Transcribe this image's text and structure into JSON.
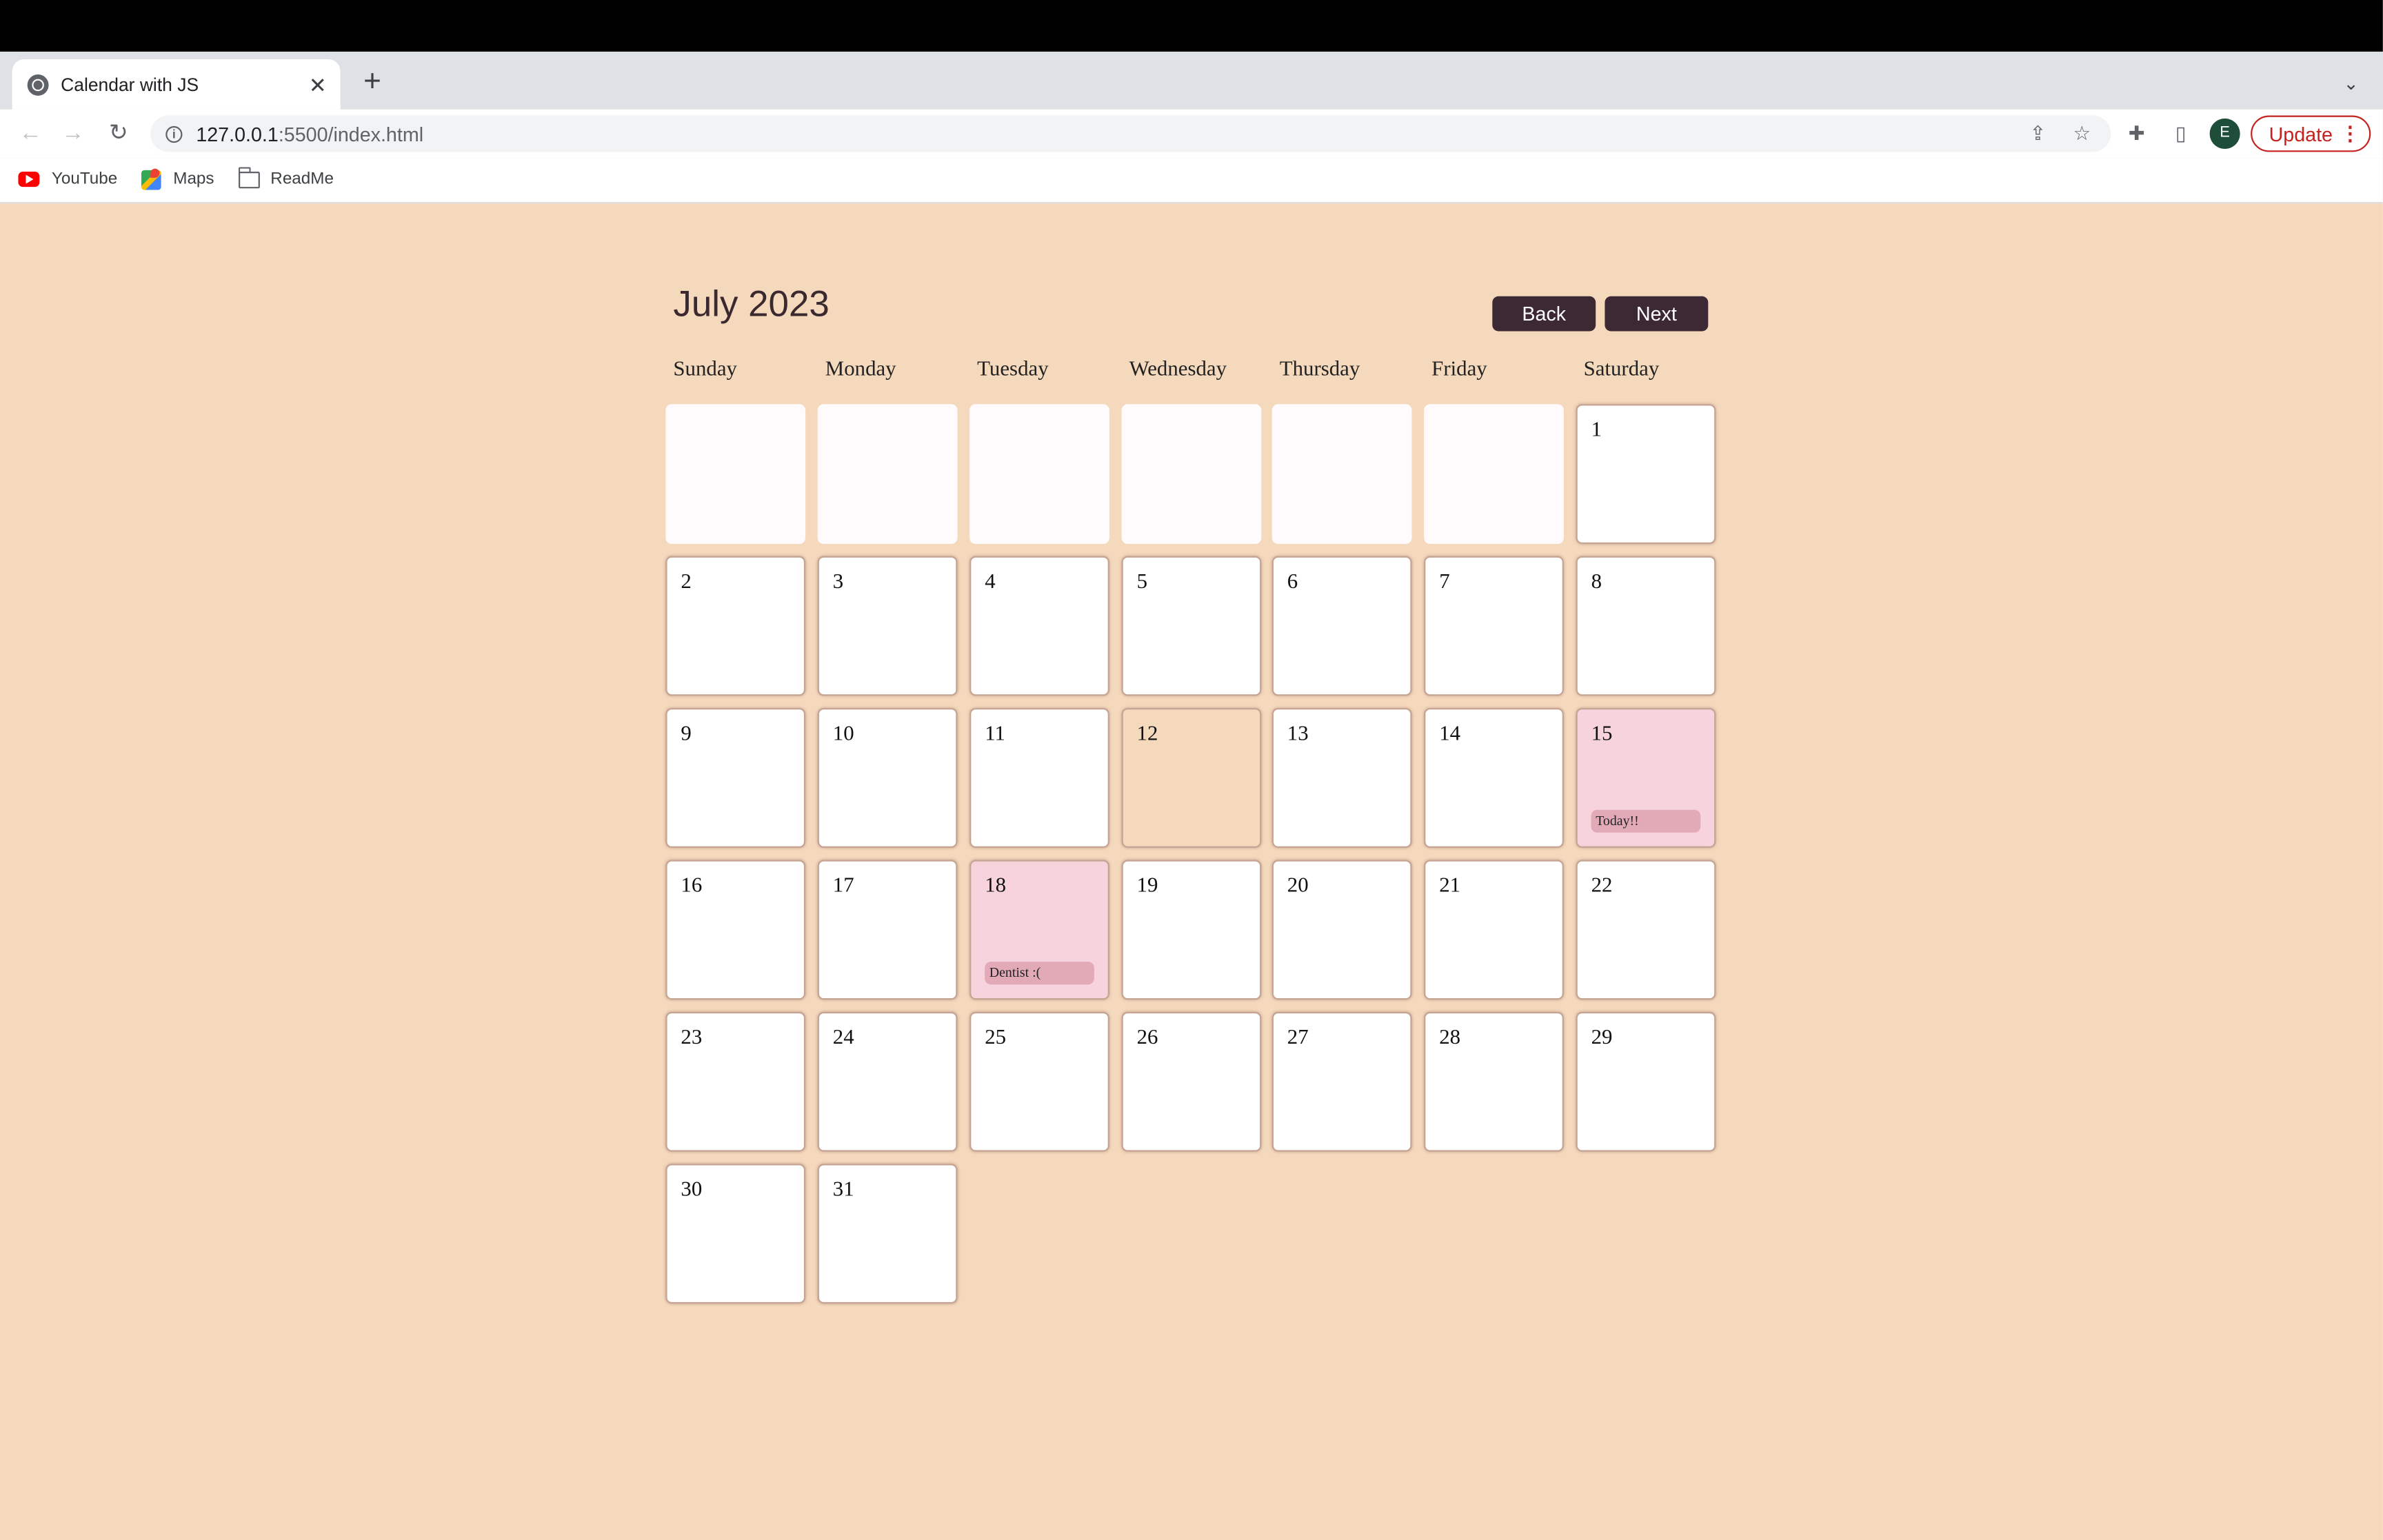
{
  "browser": {
    "tab_title": "Calendar with JS",
    "tab_close": "✕",
    "new_tab": "+",
    "tab_search": "⌄",
    "url_host": "127.0.0.1",
    "url_rest": ":5500/index.html",
    "update_label": "Update",
    "avatar_initial": "E",
    "bookmarks": [
      "YouTube",
      "Maps",
      "ReadMe"
    ]
  },
  "calendar": {
    "month_label": "July 2023",
    "back_label": "Back",
    "next_label": "Next",
    "weekdays": [
      "Sunday",
      "Monday",
      "Tuesday",
      "Wednesday",
      "Thursday",
      "Friday",
      "Saturday"
    ],
    "leading_blank_days": 6,
    "days_in_month": 31,
    "current_day": 12,
    "events": [
      {
        "day": 15,
        "title": "Today!!"
      },
      {
        "day": 18,
        "title": "Dentist :("
      }
    ]
  },
  "colors": {
    "page_background": "#f5d9bd",
    "button_background": "#3d2933",
    "event_background": "#e2a9b7",
    "event_day_background": "#f7d4dd",
    "current_day_background": "#f5d9bd",
    "update_button": "#c5221f"
  },
  "icons": {
    "back": "arrow-left-icon",
    "forward": "arrow-right-icon",
    "reload": "reload-icon",
    "site_info": "info-icon",
    "share": "share-icon",
    "bookmark": "star-icon",
    "extensions": "puzzle-icon",
    "side_panel": "side-panel-icon",
    "menu": "more-vert-icon"
  }
}
